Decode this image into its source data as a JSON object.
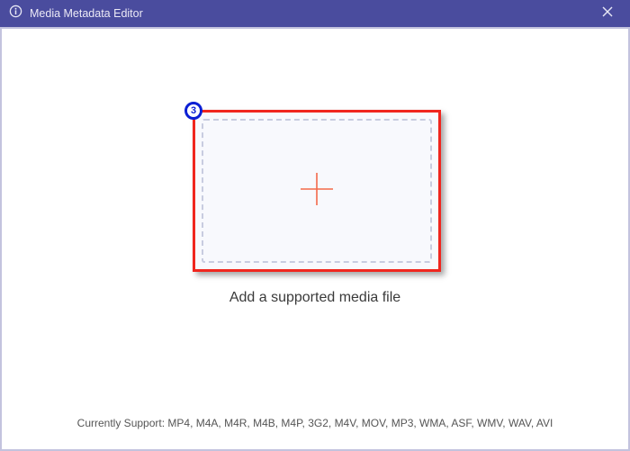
{
  "titlebar": {
    "title": "Media Metadata Editor"
  },
  "step_badge": {
    "number": "3"
  },
  "dropzone": {
    "instruction": "Add a supported media file"
  },
  "footer": {
    "label": "Currently Support: ",
    "formats": "MP4, M4A, M4R, M4B, M4P, 3G2, M4V, MOV, MP3, WMA, ASF, WMV, WAV, AVI"
  }
}
